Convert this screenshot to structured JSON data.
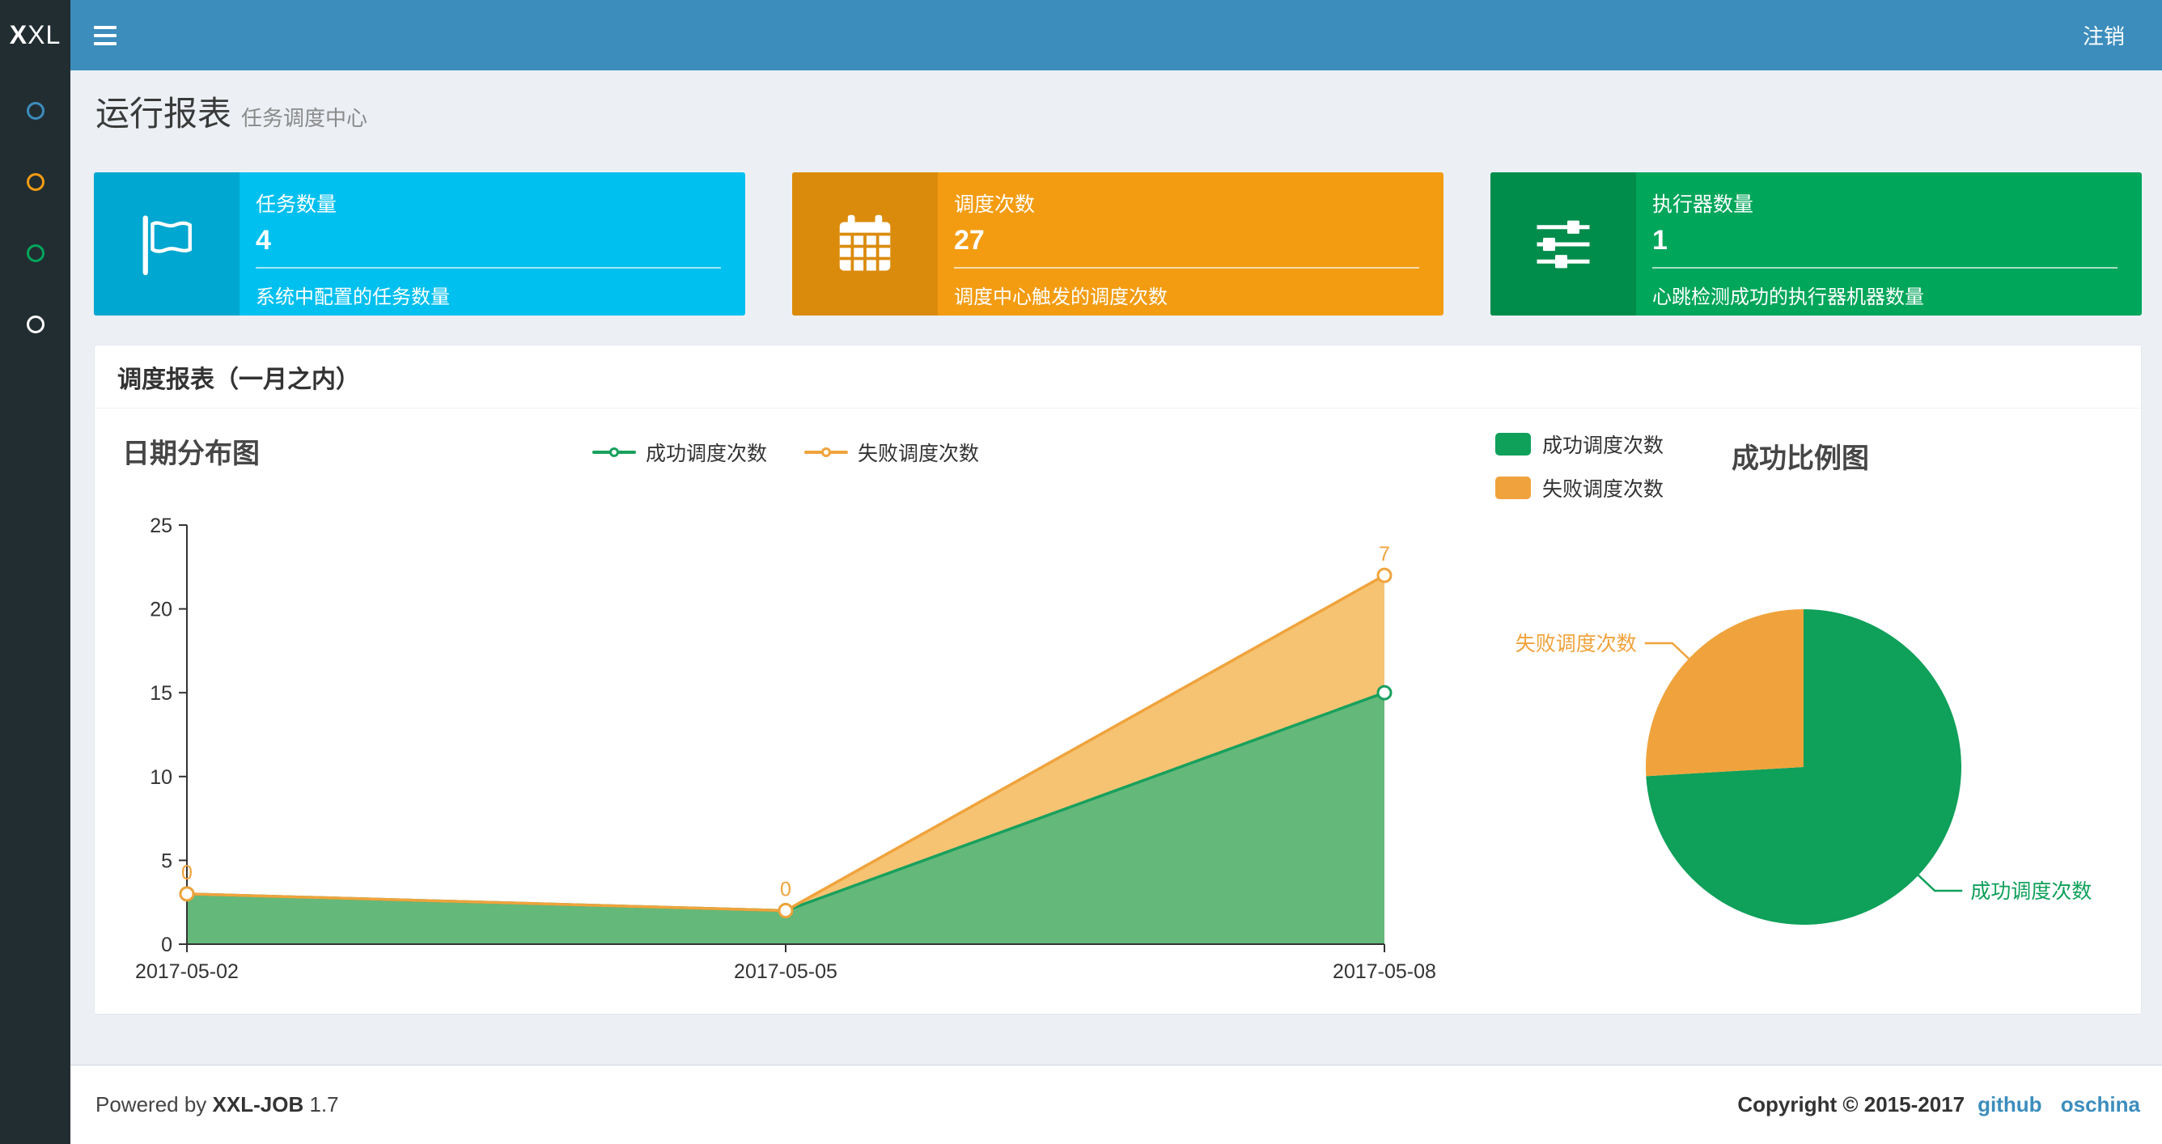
{
  "theme": {
    "navbar_bg": "#3c8dbc",
    "sidebar_bg": "#222d32",
    "content_bg": "#ecf0f5",
    "footer_border": "#d2d6de",
    "link_color": "#3c8dbc"
  },
  "navbar": {
    "logo_bold": "X",
    "logo_rest": "XL",
    "logout_label": "注销"
  },
  "sidebar": {
    "items": [
      {
        "icon": "circle-outline-icon",
        "color": "#3c8dbc"
      },
      {
        "icon": "circle-outline-icon",
        "color": "#f39c12"
      },
      {
        "icon": "circle-outline-icon",
        "color": "#00a65a"
      },
      {
        "icon": "circle-outline-icon",
        "color": "#ffffff"
      }
    ]
  },
  "page_header": {
    "title": "运行报表",
    "subtitle": "任务调度中心"
  },
  "info_boxes": [
    {
      "title": "任务数量",
      "value": "4",
      "desc": "系统中配置的任务数量",
      "bg": "#00c0ef",
      "icon_bg": "#00a7d0",
      "icon": "flag-icon"
    },
    {
      "title": "调度次数",
      "value": "27",
      "desc": "调度中心触发的调度次数",
      "bg": "#f39c12",
      "icon_bg": "#db8b0b",
      "icon": "calendar-icon"
    },
    {
      "title": "执行器数量",
      "value": "1",
      "desc": "心跳检测成功的执行器机器数量",
      "bg": "#00a65a",
      "icon_bg": "#008d4c",
      "icon": "sliders-icon"
    }
  ],
  "panel": {
    "title": "调度报表（一月之内）"
  },
  "chart_data": [
    {
      "type": "area",
      "title": "日期分布图",
      "x": [
        "2017-05-02",
        "2017-05-05",
        "2017-05-08"
      ],
      "stacked": true,
      "ylim": [
        0,
        25
      ],
      "yticks": [
        0,
        5,
        10,
        15,
        20,
        25
      ],
      "grid": false,
      "legend_position": "top-center",
      "series": [
        {
          "name": "成功调度次数",
          "values": [
            3,
            2,
            15
          ],
          "color": "#18a05d",
          "fill": "#5cb473",
          "show_labels": false,
          "labels": []
        },
        {
          "name": "失败调度次数",
          "values": [
            0,
            0,
            7
          ],
          "color": "#f0a33c",
          "fill": "#f5c06b",
          "show_labels": true,
          "labels": [
            "0",
            "0",
            "7"
          ]
        }
      ]
    },
    {
      "type": "pie",
      "title": "成功比例图",
      "legend_position": "top-left",
      "start_angle": "top",
      "clockwise": true,
      "slices": [
        {
          "name": "成功调度次数",
          "value": 20,
          "color": "#0fa05a"
        },
        {
          "name": "失败调度次数",
          "value": 7,
          "color": "#f0a33c"
        }
      ]
    }
  ],
  "footer": {
    "powered_prefix": "Powered by ",
    "brand": "XXL-JOB",
    "version": " 1.7",
    "copyright": "Copyright © 2015-2017",
    "links": [
      {
        "label": "github"
      },
      {
        "label": "oschina"
      }
    ]
  }
}
